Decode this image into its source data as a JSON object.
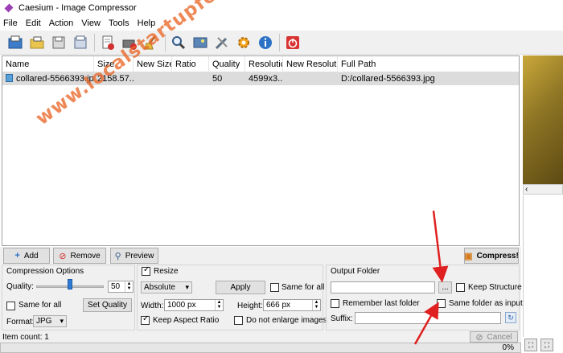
{
  "window": {
    "title": "Caesium - Image Compressor"
  },
  "menu": [
    "File",
    "Edit",
    "Action",
    "View",
    "Tools",
    "Help"
  ],
  "toolbar": {
    "icons": [
      "add-files-icon",
      "add-folder-icon",
      "save-icon",
      "export-icon",
      "remove-icon",
      "clear-list-icon",
      "broom-icon",
      "zoom-icon",
      "preview-icon",
      "settings-tools-icon",
      "gear-icon",
      "info-icon",
      "power-icon"
    ]
  },
  "table": {
    "columns": [
      "Name",
      "Size",
      "New Size",
      "Ratio",
      "Quality",
      "Resolution",
      "New Resolution",
      "Full Path"
    ],
    "column_labels_visible": [
      "Name",
      "Size",
      "New Size",
      "Ratio",
      "Quality",
      "Resolutic",
      "New Resolutio",
      "Full Path"
    ],
    "rows": [
      {
        "name": "collared-5566393.jpg",
        "size": "2158.57...",
        "new_size": "",
        "ratio": "",
        "quality": "50",
        "resolution": "4599x3...",
        "new_resolution": "",
        "full_path": "D:/collared-5566393.jpg"
      }
    ]
  },
  "watermark": "www.localstartupfest.id",
  "buttons": {
    "add": "Add",
    "remove": "Remove",
    "preview": "Preview",
    "compress": "Compress!"
  },
  "compression": {
    "title": "Compression Options",
    "quality_label": "Quality:",
    "quality_value": "50",
    "same_for_all": "Same for all",
    "set_quality": "Set Quality",
    "format_label": "Format:",
    "format_value": "JPG"
  },
  "resize": {
    "title": "Resize",
    "checked": true,
    "mode": "Absolute",
    "apply": "Apply",
    "same_for_all": "Same for all",
    "width_label": "Width:",
    "width_value": "1000 px",
    "height_label": "Height:",
    "height_value": "666 px",
    "keep_aspect": "Keep Aspect Ratio",
    "no_enlarge": "Do not enlarge images"
  },
  "output": {
    "title": "Output Folder",
    "browse": "...",
    "keep_structure": "Keep Structure",
    "remember_last": "Remember last folder",
    "same_folder": "Same folder as input",
    "suffix_label": "Suffix:"
  },
  "status": {
    "item_count": "Item count: 1",
    "cancel": "Cancel",
    "progress": "0%"
  },
  "colors": {
    "accent_arrow": "#e02020",
    "watermark": "#e96828",
    "selected_row": "#dcdcdc"
  }
}
